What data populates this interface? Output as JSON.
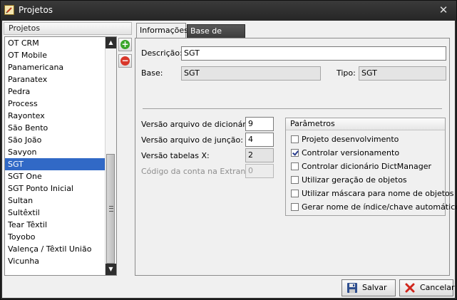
{
  "window": {
    "title": "Projetos"
  },
  "left": {
    "header": "Projetos",
    "items": [
      "OT CRM",
      "OT Mobile",
      "Panamericana",
      "Paranatex",
      "Pedra",
      "Process",
      "Rayontex",
      "São Bento",
      "São João",
      "Savyon",
      "SGT",
      "SGT One",
      "SGT Ponto Inicial",
      "Sultan",
      "Sultêxtil",
      "Tear Têxtil",
      "Toyobo",
      "Valença / Têxtil União",
      "Vicunha"
    ],
    "selected": "SGT"
  },
  "tabs": [
    {
      "label": "Informações",
      "active": true
    },
    {
      "label": "Base de dados",
      "active": false
    }
  ],
  "form": {
    "descricao_label": "Descrição:",
    "descricao_value": "SGT",
    "base_label": "Base:",
    "base_value": "SGT",
    "tipo_label": "Tipo:",
    "tipo_value": "SGT",
    "versao_dic_label": "Versão arquivo de dicionário:",
    "versao_dic_value": "9",
    "versao_jun_label": "Versão arquivo de junção:",
    "versao_jun_value": "4",
    "versao_tab_label": "Versão tabelas X:",
    "versao_tab_value": "2",
    "codigo_label": "Código da conta na Extranet:",
    "codigo_value": "0"
  },
  "parametros": {
    "title": "Parâmetros",
    "options": [
      {
        "label": "Projeto desenvolvimento",
        "checked": false
      },
      {
        "label": "Controlar versionamento",
        "checked": true
      },
      {
        "label": "Controlar dicionário DictManager",
        "checked": false
      },
      {
        "label": "Utilizar geração de objetos",
        "checked": false
      },
      {
        "label": "Utilizar máscara para nome de objetos",
        "checked": false
      },
      {
        "label": "Gerar nome de índice/chave automático",
        "checked": false
      }
    ]
  },
  "buttons": {
    "save": "Salvar",
    "cancel": "Cancelar"
  },
  "icons": {
    "add": "add-icon",
    "remove": "remove-icon",
    "save": "floppy-disk-icon",
    "cancel": "red-x-icon"
  }
}
